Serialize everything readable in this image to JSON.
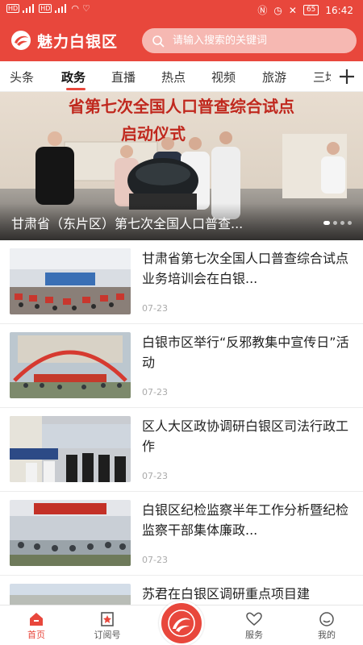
{
  "status_bar": {
    "time": "16:42",
    "battery": "65",
    "sim_label_1": "HD",
    "sim_label_2": "HD"
  },
  "header": {
    "app_title": "魅力白银区",
    "search_placeholder": "请输入搜索的关键词",
    "accent_color": "#e8473c"
  },
  "tabs": [
    {
      "label": "头条"
    },
    {
      "label": "政务",
      "active": true
    },
    {
      "label": "直播"
    },
    {
      "label": "热点"
    },
    {
      "label": "视频"
    },
    {
      "label": "旅游"
    },
    {
      "label": "三均"
    }
  ],
  "banner": {
    "image_heading_line1": "省第七次全国人口普查综合试点",
    "image_heading_line2": "启动仪式",
    "caption": "甘肃省（东片区）第七次全国人口普查...",
    "slide_index": 1,
    "slide_count": 4
  },
  "news": [
    {
      "title": "甘肃省第七次全国人口普查综合试点业务培训会在白银...",
      "date": "07-23"
    },
    {
      "title": "白银市区举行“反邪教集中宣传日”活动",
      "date": "07-23"
    },
    {
      "title": "区人大区政协调研白银区司法行政工作",
      "date": "07-23"
    },
    {
      "title": "白银区纪检监察半年工作分析暨纪检监察干部集体廉政...",
      "date": "07-23"
    },
    {
      "title": "苏君在白银区调研重点项目建",
      "date": ""
    }
  ],
  "bottom_nav": [
    {
      "label": "首页",
      "icon": "home-icon",
      "active": true
    },
    {
      "label": "订阅号",
      "icon": "subscribe-icon"
    },
    {
      "label": "",
      "icon": "center-logo-icon"
    },
    {
      "label": "服务",
      "icon": "heart-hand-icon"
    },
    {
      "label": "我的",
      "icon": "profile-icon"
    }
  ]
}
